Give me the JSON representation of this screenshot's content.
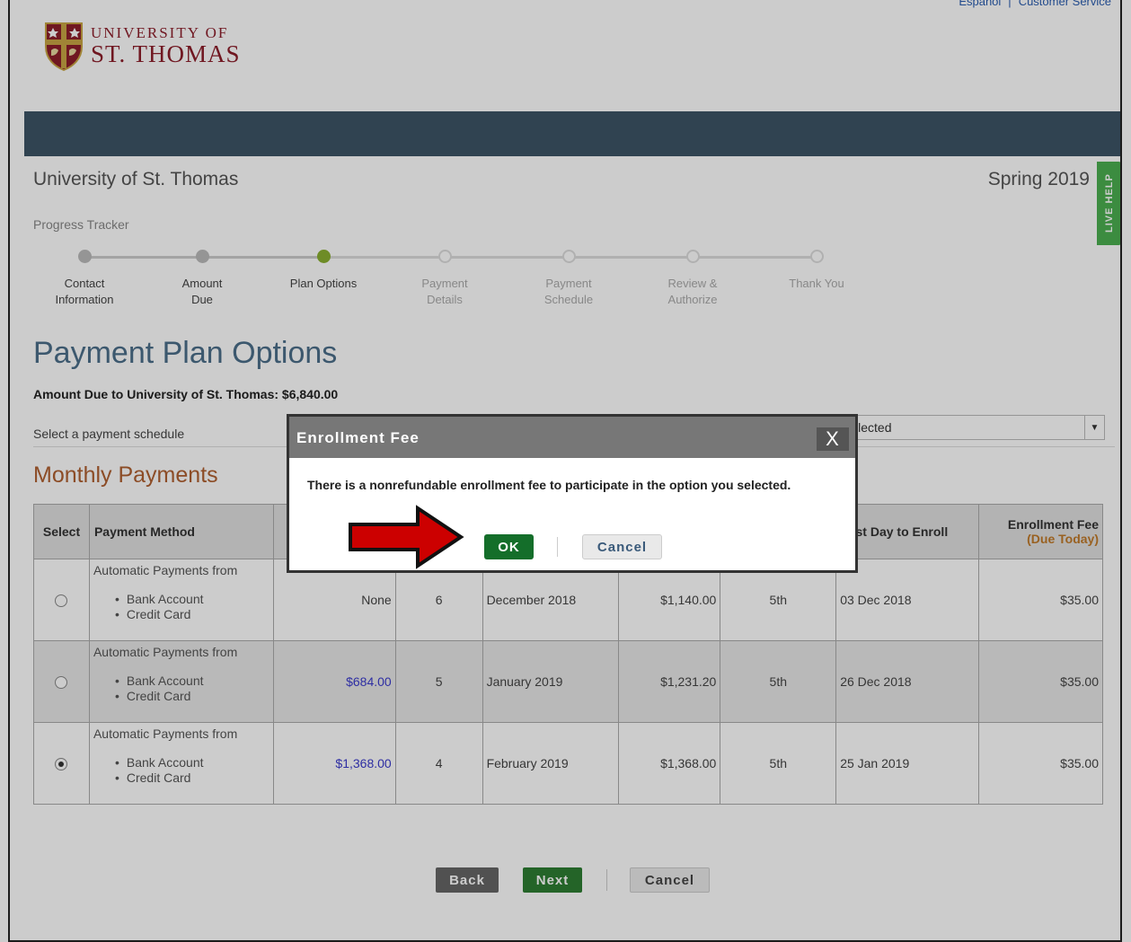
{
  "header": {
    "top_links": [
      "Español",
      "|",
      "Customer Service"
    ],
    "logo_line1": "UNIVERSITY OF",
    "logo_line2": "ST. THOMAS"
  },
  "school_name": "University of St. Thomas",
  "term": "Spring 2019",
  "live_help": "LIVE HELP",
  "progress": {
    "title": "Progress Tracker",
    "steps": [
      {
        "label1": "Contact",
        "label2": "Information",
        "state": "done"
      },
      {
        "label1": "Amount",
        "label2": "Due",
        "state": "done"
      },
      {
        "label1": "Plan Options",
        "label2": "",
        "state": "current"
      },
      {
        "label1": "Payment",
        "label2": "Details",
        "state": "future"
      },
      {
        "label1": "Payment",
        "label2": "Schedule",
        "state": "future"
      },
      {
        "label1": "Review &",
        "label2": "Authorize",
        "state": "future"
      },
      {
        "label1": "Thank You",
        "label2": "",
        "state": "future"
      }
    ]
  },
  "page_title": "Payment Plan Options",
  "amount_due": "Amount Due to University of St. Thomas: $6,840.00",
  "schedule_label": "Select a payment schedule",
  "schedule_select_value": "Selected",
  "section_title": "Monthly Payments",
  "table": {
    "headers": {
      "select": "Select",
      "method": "Payment Method",
      "last_day": "Last Day to Enroll",
      "fee": "Enrollment Fee",
      "fee_sub": "(Due Today)"
    },
    "rows": [
      {
        "method_title": "Automatic Payments from",
        "method_items": [
          "Bank Account",
          "Credit Card"
        ],
        "down": "None",
        "count": "6",
        "start": "December 2018",
        "amount": "$1,140.00",
        "day": "5th",
        "last_day": "03 Dec 2018",
        "fee": "$35.00",
        "selected": false
      },
      {
        "method_title": "Automatic Payments from",
        "method_items": [
          "Bank Account",
          "Credit Card"
        ],
        "down": "$684.00",
        "count": "5",
        "start": "January 2019",
        "amount": "$1,231.20",
        "day": "5th",
        "last_day": "26 Dec 2018",
        "fee": "$35.00",
        "selected": false
      },
      {
        "method_title": "Automatic Payments from",
        "method_items": [
          "Bank Account",
          "Credit Card"
        ],
        "down": "$1,368.00",
        "count": "4",
        "start": "February 2019",
        "amount": "$1,368.00",
        "day": "5th",
        "last_day": "25 Jan 2019",
        "fee": "$35.00",
        "selected": true
      }
    ]
  },
  "buttons": {
    "back": "Back",
    "next": "Next",
    "cancel": "Cancel"
  },
  "modal": {
    "title": "Enrollment Fee",
    "close": "X",
    "message": "There is a nonrefundable enrollment fee to participate in the option you selected.",
    "ok": "OK",
    "cancel": "Cancel"
  },
  "colors": {
    "nav_band": "#3c5466",
    "accent_green": "#146e2a",
    "arrow_red": "#cc0000",
    "heading_blue": "#4b6e8a",
    "section_orange": "#b06030"
  }
}
